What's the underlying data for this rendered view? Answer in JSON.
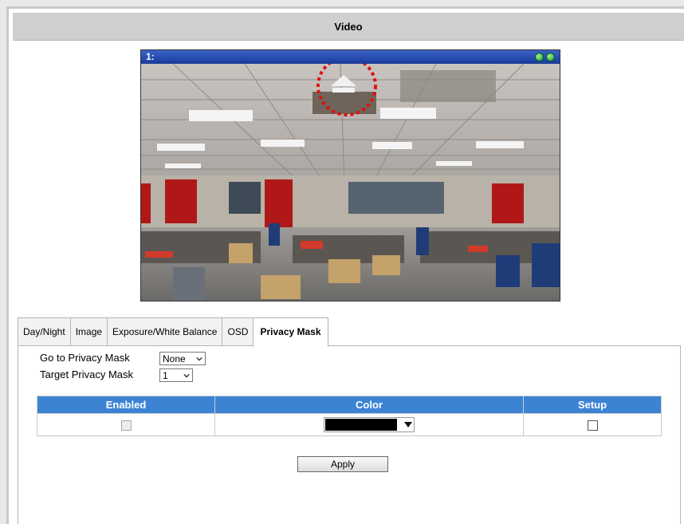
{
  "header": {
    "title": "Video"
  },
  "video": {
    "channel_label": "1:"
  },
  "tabs": [
    {
      "label": "Day/Night"
    },
    {
      "label": "Image"
    },
    {
      "label": "Exposure/White Balance"
    },
    {
      "label": "OSD"
    },
    {
      "label": "Privacy Mask",
      "active": true
    }
  ],
  "form": {
    "goto_label": "Go to Privacy Mask",
    "goto_value": "None",
    "target_label": "Target Privacy Mask",
    "target_value": "1"
  },
  "table": {
    "headers": [
      "Enabled",
      "Color",
      "Setup"
    ],
    "row": {
      "enabled_checked": false,
      "enabled_disabled": true,
      "color": "#000000",
      "setup_checked": false
    }
  },
  "apply_label": "Apply",
  "colors": {
    "accent": "#3c83d4",
    "highlight_circle": "#e01010"
  }
}
